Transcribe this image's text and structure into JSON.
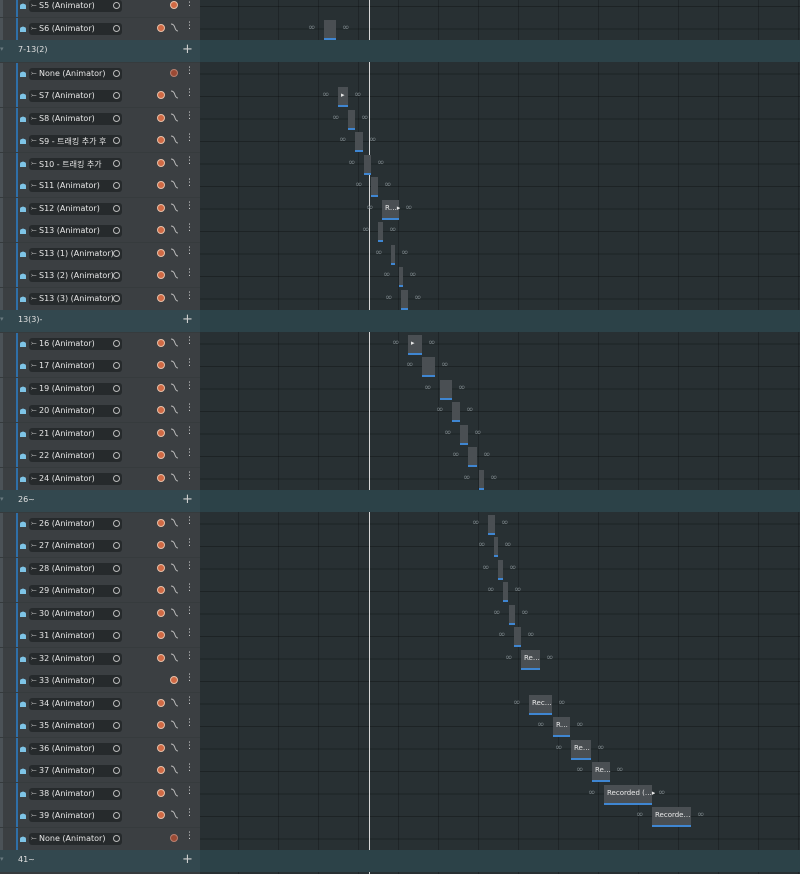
{
  "colors": {
    "accent": "#2f6fa8",
    "clip_bar": "#3f86d2",
    "record": "#d06a45",
    "group_bg": "#33484f"
  },
  "rows": [
    {
      "kind": "track",
      "label": "S5 (Animator)",
      "curve": false
    },
    {
      "kind": "track",
      "label": "S6 (Animator)",
      "curve": true
    },
    {
      "kind": "group",
      "label": "7-13(2)"
    },
    {
      "kind": "track",
      "label": "None (Animator)",
      "curve": false,
      "dim": true
    },
    {
      "kind": "track",
      "label": "S7 (Animator)",
      "curve": true
    },
    {
      "kind": "track",
      "label": "S8 (Animator)",
      "curve": true
    },
    {
      "kind": "track",
      "label": "S9 - 트래킹 추가 후",
      "curve": true
    },
    {
      "kind": "track",
      "label": "S10 - 트래킹 추가",
      "curve": true
    },
    {
      "kind": "track",
      "label": "S11 (Animator)",
      "curve": true
    },
    {
      "kind": "track",
      "label": "S12 (Animator)",
      "curve": true
    },
    {
      "kind": "track",
      "label": "S13 (Animator)",
      "curve": true
    },
    {
      "kind": "track",
      "label": "S13 (1) (Animator)",
      "curve": true
    },
    {
      "kind": "track",
      "label": "S13 (2) (Animator)",
      "curve": true
    },
    {
      "kind": "track",
      "label": "S13 (3) (Animator)",
      "curve": true
    },
    {
      "kind": "group",
      "label": "13(3)-"
    },
    {
      "kind": "track",
      "label": "16 (Animator)",
      "curve": true
    },
    {
      "kind": "track",
      "label": "17 (Animator)",
      "curve": true
    },
    {
      "kind": "track",
      "label": "19 (Animator)",
      "curve": true
    },
    {
      "kind": "track",
      "label": "20 (Animator)",
      "curve": true
    },
    {
      "kind": "track",
      "label": "21 (Animator)",
      "curve": true
    },
    {
      "kind": "track",
      "label": "22 (Animator)",
      "curve": true
    },
    {
      "kind": "track",
      "label": "24 (Animator)",
      "curve": true
    },
    {
      "kind": "group",
      "label": "26~"
    },
    {
      "kind": "track",
      "label": "26 (Animator)",
      "curve": true
    },
    {
      "kind": "track",
      "label": "27 (Animator)",
      "curve": true
    },
    {
      "kind": "track",
      "label": "28 (Animator)",
      "curve": true
    },
    {
      "kind": "track",
      "label": "29 (Animator)",
      "curve": true
    },
    {
      "kind": "track",
      "label": "30 (Animator)",
      "curve": true
    },
    {
      "kind": "track",
      "label": "31 (Animator)",
      "curve": true
    },
    {
      "kind": "track",
      "label": "32 (Animator)",
      "curve": true
    },
    {
      "kind": "track",
      "label": "33 (Animator)",
      "curve": false
    },
    {
      "kind": "track",
      "label": "34 (Animator)",
      "curve": true
    },
    {
      "kind": "track",
      "label": "35 (Animator)",
      "curve": true
    },
    {
      "kind": "track",
      "label": "36 (Animator)",
      "curve": true
    },
    {
      "kind": "track",
      "label": "37 (Animator)",
      "curve": true
    },
    {
      "kind": "track",
      "label": "38 (Animator)",
      "curve": true
    },
    {
      "kind": "track",
      "label": "39 (Animator)",
      "curve": true
    },
    {
      "kind": "track",
      "label": "None (Animator)",
      "curve": false,
      "dim": true
    },
    {
      "kind": "group",
      "label": "41~"
    }
  ],
  "clip_labels": {
    "s7": "▸",
    "s12": "R…▸",
    "t16": "▸",
    "t32": "Re…",
    "t34": "Rec…",
    "t35": "R…",
    "t36": "Re…",
    "t37": "Re…",
    "t38": "Recorded (…▸",
    "t39": "Recorde…"
  },
  "infinity_symbol": "∞"
}
